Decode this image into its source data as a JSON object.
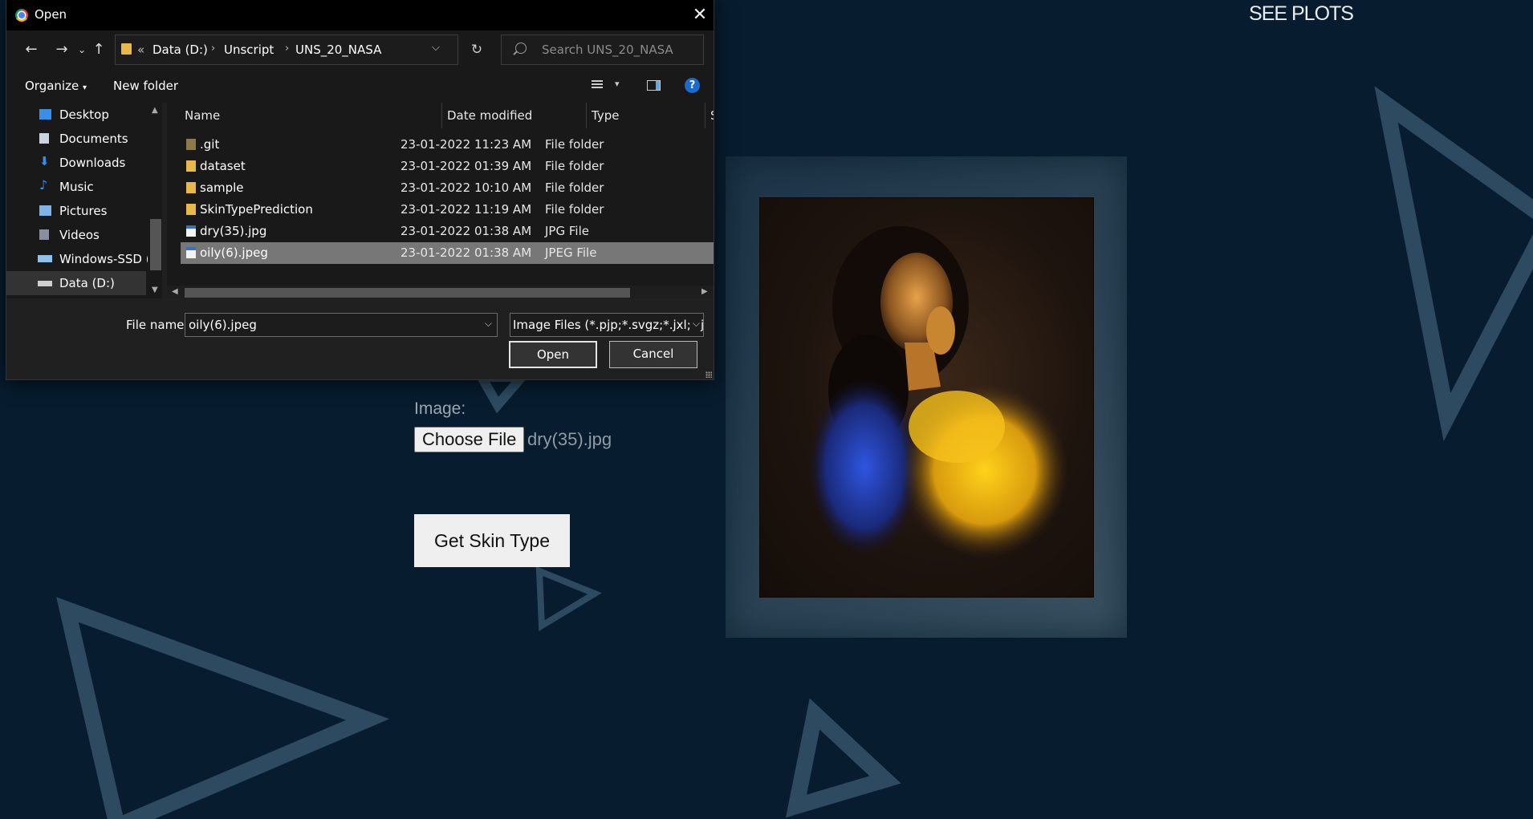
{
  "page": {
    "see_plots": "SEE PLOTS",
    "image_label": "Image:",
    "choose_file_label": "Choose File",
    "chosen_file": "dry(35).jpg",
    "submit_label": "Get Skin Type",
    "background_color": "#071c2e",
    "triangle_color": "#2d4a60"
  },
  "dialog": {
    "title": "Open",
    "app_icon": "chrome-icon",
    "breadcrumb": {
      "overflow": "«",
      "items": [
        "Data (D:)",
        "Unscript",
        "UNS_20_NASA"
      ]
    },
    "search_placeholder": "Search UNS_20_NASA",
    "toolbar": {
      "organize": "Organize",
      "new_folder": "New folder",
      "help": "?"
    },
    "sidebar": [
      {
        "label": "Desktop",
        "icon": "desktop-icon",
        "color": "#3b8ee8"
      },
      {
        "label": "Documents",
        "icon": "documents-icon",
        "color": "#c9d4de"
      },
      {
        "label": "Downloads",
        "icon": "downloads-icon",
        "color": "#3b8ee8"
      },
      {
        "label": "Music",
        "icon": "music-icon",
        "color": "#3b8ee8"
      },
      {
        "label": "Pictures",
        "icon": "pictures-icon",
        "color": "#7fb4e8"
      },
      {
        "label": "Videos",
        "icon": "videos-icon",
        "color": "#8a8fa0"
      },
      {
        "label": "Windows-SSD (C",
        "icon": "drive-c-icon",
        "color": "#8fc1ec"
      },
      {
        "label": "Data (D:)",
        "icon": "drive-d-icon",
        "color": "#cfcfcf",
        "selected": true
      }
    ],
    "columns": [
      "Name",
      "Date modified",
      "Type",
      "S"
    ],
    "files": [
      {
        "name": ".git",
        "date": "23-01-2022 11:23 AM",
        "type": "File folder",
        "icon": "folder-icon"
      },
      {
        "name": "dataset",
        "date": "23-01-2022 01:39 AM",
        "type": "File folder",
        "icon": "folder-icon"
      },
      {
        "name": "sample",
        "date": "23-01-2022 10:10 AM",
        "type": "File folder",
        "icon": "folder-icon"
      },
      {
        "name": "SkinTypePrediction",
        "date": "23-01-2022 11:19 AM",
        "type": "File folder",
        "icon": "folder-icon"
      },
      {
        "name": "dry(35).jpg",
        "date": "23-01-2022 01:38 AM",
        "type": "JPG File",
        "icon": "image-file-icon"
      },
      {
        "name": "oily(6).jpeg",
        "date": "23-01-2022 01:38 AM",
        "type": "JPEG File",
        "icon": "image-file-icon",
        "selected": true
      }
    ],
    "file_name_label": "File name:",
    "file_name_value": "oily(6).jpeg",
    "file_type_value": "Image Files (*.pjp;*.svgz;*.jxl;*.jp",
    "open_button": "Open",
    "cancel_button": "Cancel"
  }
}
